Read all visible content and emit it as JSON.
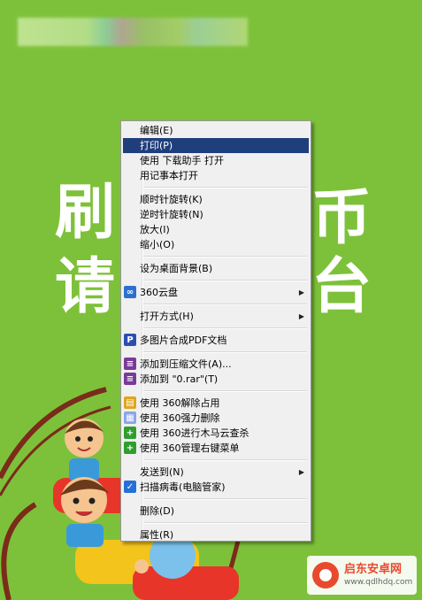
{
  "background": {
    "color": "#7dc13a",
    "big_chars": [
      "刷",
      "币",
      "请",
      "台"
    ]
  },
  "watermark": {
    "title": "启东安卓网",
    "url": "www.qdlhdq.com"
  },
  "context_menu": {
    "highlight_color": "#1f3e7c",
    "groups": [
      {
        "items": [
          {
            "label": "编辑(E)",
            "icon": null,
            "submenu": false
          },
          {
            "label": "打印(P)",
            "icon": null,
            "submenu": false,
            "highlighted": true
          },
          {
            "label": "使用 下载助手 打开",
            "icon": null,
            "submenu": false
          },
          {
            "label": "用记事本打开",
            "icon": null,
            "submenu": false
          }
        ]
      },
      {
        "items": [
          {
            "label": "顺时针旋转(K)",
            "icon": null,
            "submenu": false
          },
          {
            "label": "逆时针旋转(N)",
            "icon": null,
            "submenu": false
          },
          {
            "label": "放大(I)",
            "icon": null,
            "submenu": false
          },
          {
            "label": "缩小(O)",
            "icon": null,
            "submenu": false
          }
        ]
      },
      {
        "items": [
          {
            "label": "设为桌面背景(B)",
            "icon": null,
            "submenu": false
          }
        ]
      },
      {
        "items": [
          {
            "label": "360云盘",
            "icon": "cloud-icon",
            "submenu": true
          }
        ]
      },
      {
        "items": [
          {
            "label": "打开方式(H)",
            "icon": null,
            "submenu": true
          }
        ]
      },
      {
        "items": [
          {
            "label": "多图片合成PDF文档",
            "icon": "pdf-icon",
            "submenu": false
          }
        ]
      },
      {
        "items": [
          {
            "label": "添加到压缩文件(A)...",
            "icon": "archive-icon",
            "submenu": false
          },
          {
            "label": "添加到 \"0.rar\"(T)",
            "icon": "archive-icon",
            "submenu": false
          }
        ]
      },
      {
        "items": [
          {
            "label": "使用 360解除占用",
            "icon": "unlock-icon",
            "submenu": false
          },
          {
            "label": "使用 360强力删除",
            "icon": "shred-icon",
            "submenu": false
          },
          {
            "label": "使用 360进行木马云查杀",
            "icon": "shield-plus-icon",
            "submenu": false
          },
          {
            "label": "使用 360管理右键菜单",
            "icon": "shield-plus-icon",
            "submenu": false
          }
        ]
      },
      {
        "items": [
          {
            "label": "发送到(N)",
            "icon": null,
            "submenu": true
          },
          {
            "label": "扫描病毒(电脑管家)",
            "icon": "antivirus-icon",
            "submenu": false
          }
        ]
      },
      {
        "items": [
          {
            "label": "删除(D)",
            "icon": null,
            "submenu": false
          }
        ]
      },
      {
        "items": [
          {
            "label": "属性(R)",
            "icon": null,
            "submenu": false
          }
        ]
      }
    ]
  }
}
